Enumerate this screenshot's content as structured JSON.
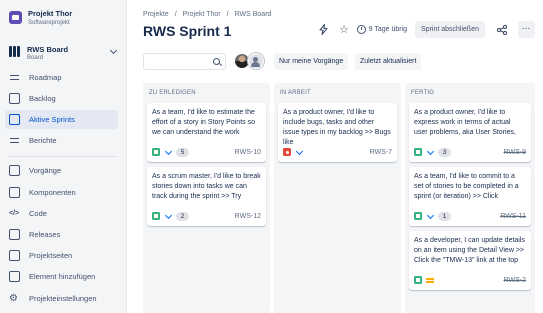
{
  "project": {
    "name": "Projekt Thor",
    "type": "Softwareprojekt"
  },
  "board": {
    "name": "RWS Board",
    "type": "Board"
  },
  "nav": {
    "main": [
      {
        "label": "Roadmap",
        "icon": "roadmap-icon",
        "active": false
      },
      {
        "label": "Backlog",
        "icon": "backlog-icon",
        "active": false
      },
      {
        "label": "Aktive Sprints",
        "icon": "active-sprints-icon",
        "active": true
      },
      {
        "label": "Berichte",
        "icon": "reports-icon",
        "active": false
      }
    ],
    "secondary": [
      {
        "label": "Vorgänge",
        "icon": "issues-icon"
      },
      {
        "label": "Komponenten",
        "icon": "components-icon"
      },
      {
        "label": "Code",
        "icon": "code-icon"
      },
      {
        "label": "Releases",
        "icon": "releases-icon"
      },
      {
        "label": "Projektseiten",
        "icon": "pages-icon"
      },
      {
        "label": "Element hinzufügen",
        "icon": "add-item-icon"
      },
      {
        "label": "Projekteinstellungen",
        "icon": "settings-icon"
      }
    ]
  },
  "breadcrumb": [
    "Projekte",
    "Projekt Thor",
    "RWS Board"
  ],
  "breadcrumb_sep": "/",
  "page_title": "RWS Sprint 1",
  "header": {
    "days_left": "9 Tage übrig",
    "complete_sprint": "Sprint abschließen",
    "more": "···"
  },
  "toolbar": {
    "search_placeholder": "",
    "only_my_issues": "Nur meine Vorgänge",
    "recently_updated": "Zuletzt aktualisiert"
  },
  "columns": [
    {
      "title": "ZU ERLEDIGEN",
      "cards": [
        {
          "text": "As a team, I'd like to estimate the effort of a story in Story Points so we can understand the work",
          "type": "story",
          "priority": "low",
          "estimate": "5",
          "key": "RWS-10",
          "done": false
        },
        {
          "text": "As a scrum master, I'd like to break stories down into tasks we can track during the sprint >> Try",
          "type": "story",
          "priority": "low",
          "estimate": "2",
          "key": "RWS-12",
          "done": false
        }
      ]
    },
    {
      "title": "IN ARBEIT",
      "cards": [
        {
          "text": "As a product owner, I'd like to include bugs, tasks and other issue types in my backlog >> Bugs like",
          "type": "bug",
          "priority": "low",
          "estimate": "",
          "key": "RWS-7",
          "done": false
        }
      ]
    },
    {
      "title": "FERTIG",
      "cards": [
        {
          "text": "As a product owner, I'd like to express work in terms of actual user problems, aka User Stories,",
          "type": "story",
          "priority": "low",
          "estimate": "3",
          "key": "RWS-9",
          "done": true
        },
        {
          "text": "As a team, I'd like to commit to a set of stories to be completed in a sprint (or iteration) >> Click",
          "type": "story",
          "priority": "low",
          "estimate": "1",
          "key": "RWS-11",
          "done": true
        },
        {
          "text": "As a developer, I can update details on an item using the Detail View >> Click the \"TMW-13\" link at the top",
          "type": "story",
          "priority": "medium",
          "estimate": "",
          "key": "RWS-2",
          "done": true
        }
      ]
    }
  ],
  "colors": {
    "accent": "#0052cc",
    "story": "#36b37e",
    "bug": "#e5493a",
    "priority_low": "#0065ff",
    "priority_medium": "#ffab00"
  }
}
